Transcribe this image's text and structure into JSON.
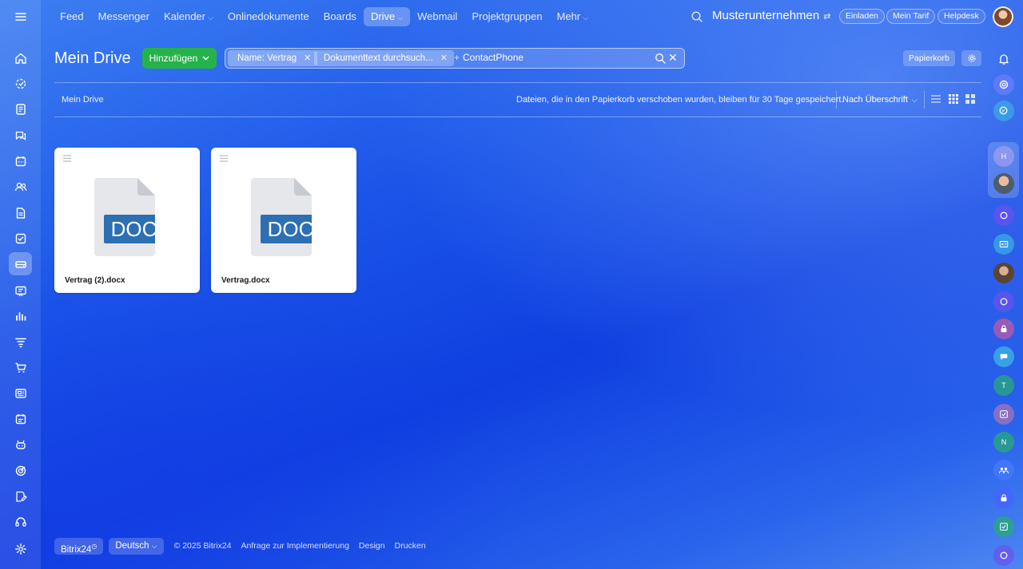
{
  "topnav": {
    "items": [
      {
        "label": "Feed",
        "dropdown": false,
        "active": false
      },
      {
        "label": "Messenger",
        "dropdown": false,
        "active": false
      },
      {
        "label": "Kalender",
        "dropdown": true,
        "active": false
      },
      {
        "label": "Onlinedokumente",
        "dropdown": false,
        "active": false
      },
      {
        "label": "Boards",
        "dropdown": false,
        "active": false
      },
      {
        "label": "Drive",
        "dropdown": true,
        "active": true
      },
      {
        "label": "Webmail",
        "dropdown": false,
        "active": false
      },
      {
        "label": "Projektgruppen",
        "dropdown": false,
        "active": false
      },
      {
        "label": "Mehr",
        "dropdown": true,
        "active": false
      }
    ],
    "company": "Musterunternehmen",
    "invite_label": "Einladen",
    "tariff_label": "Mein Tarif",
    "helpdesk_label": "Helpdesk"
  },
  "header": {
    "title": "Mein Drive",
    "add_label": "Hinzufügen",
    "trash_label": "Papierkorb"
  },
  "filter": {
    "chips": [
      {
        "label": "Name: Vertrag"
      },
      {
        "label": "Dokumenttext durchsuch..."
      }
    ],
    "search_text": "ContactPhone"
  },
  "toolbar": {
    "breadcrumb": "Mein Drive",
    "notice": "Dateien, die in den Papierkorb verschoben wurden, bleiben für 30 Tage gespeichert.",
    "sort_label": "Nach Überschrift",
    "active_view": "tiles"
  },
  "files": [
    {
      "name": "Vertrag (2).docx",
      "type_badge": "DOC",
      "icon": "doc-file-icon"
    },
    {
      "name": "Vertrag.docx",
      "type_badge": "DOC",
      "icon": "doc-file-icon"
    }
  ],
  "footer": {
    "brand": "Bitrix24",
    "language": "Deutsch",
    "copyright": "© 2025 Bitrix24",
    "links": [
      "Anfrage zur Implementierung",
      "Design",
      "Drucken"
    ]
  },
  "left_sidebar": {
    "icons": [
      "menu-icon",
      "home-icon",
      "feed-icon",
      "documents-icon",
      "chat-icon",
      "calendar-icon",
      "contacts-icon",
      "doc-icon",
      "tasks-icon",
      "drive-icon",
      "presentation-icon",
      "analytics-icon",
      "filter-icon",
      "cart-icon",
      "cards-icon",
      "schedule-icon",
      "robot-icon",
      "target-icon",
      "edit-icon",
      "headset-icon",
      "settings-icon"
    ],
    "active": "drive-icon"
  },
  "right_sidebar": {
    "avatar_letters": [
      "H",
      "T",
      "N"
    ]
  },
  "colors": {
    "accent_green": "#26b24a",
    "doc_badge": "#2c6fb2",
    "doc_page": "#e6e7ea",
    "bg_blue": "#1b55e8"
  }
}
